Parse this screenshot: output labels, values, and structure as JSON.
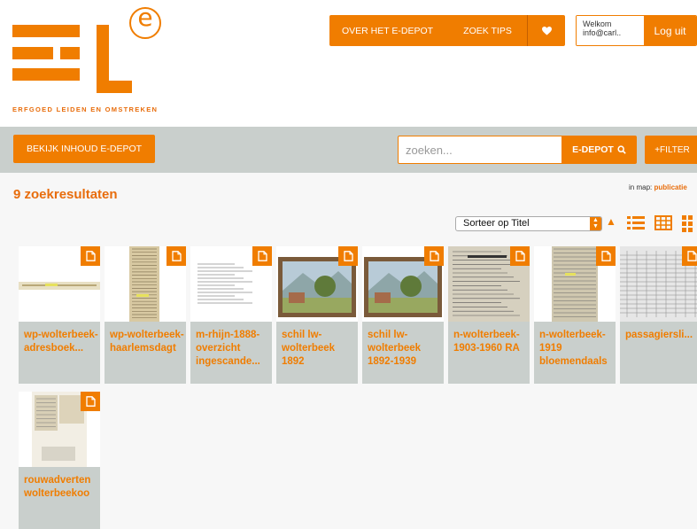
{
  "header": {
    "logo_letter": "e",
    "tagline": "ERFGOED LEIDEN EN OMSTREKEN",
    "nav": {
      "about": "OVER HET E-DEPOT",
      "tips": "ZOEK TIPS",
      "favorites_icon": "heart-icon"
    },
    "account": {
      "welcome": "Welkom",
      "email": "info@carl..",
      "logout": "Log uit"
    }
  },
  "toolbar": {
    "browse_label": "BEKIJK INHOUD E-DEPOT",
    "search_placeholder": "zoeken...",
    "search_button": "E-DEPOT",
    "filter_button": "+FILTER"
  },
  "results": {
    "count_label": "9 zoekresultaten",
    "in_map_label": "in map:",
    "in_map_link": "publicatie",
    "sort_label": "Sorteer op Titel",
    "items": [
      {
        "title": "wp-wolterbeek-adresboek...",
        "thumb": "strip"
      },
      {
        "title": "wp-wolterbeek-haarlemsdagt",
        "thumb": "clipping"
      },
      {
        "title": "m-rhijn-1888-overzicht ingescande...",
        "thumb": "text"
      },
      {
        "title": "schil lw-wolterbeek 1892",
        "thumb": "painting"
      },
      {
        "title": "schil lw-wolterbeek 1892-1939",
        "thumb": "painting"
      },
      {
        "title": "n-wolterbeek-1903-1960 RA",
        "thumb": "form"
      },
      {
        "title": "n-wolterbeek-1919 bloemendaals",
        "thumb": "register"
      },
      {
        "title": "passagiersli...",
        "thumb": "list"
      },
      {
        "title": "rouwadverten wolterbeekoo",
        "thumb": "notices"
      }
    ]
  },
  "colors": {
    "accent": "#f07d00",
    "toolbar_bg": "#c9cfcc",
    "card_bg": "#c9cfcc"
  }
}
